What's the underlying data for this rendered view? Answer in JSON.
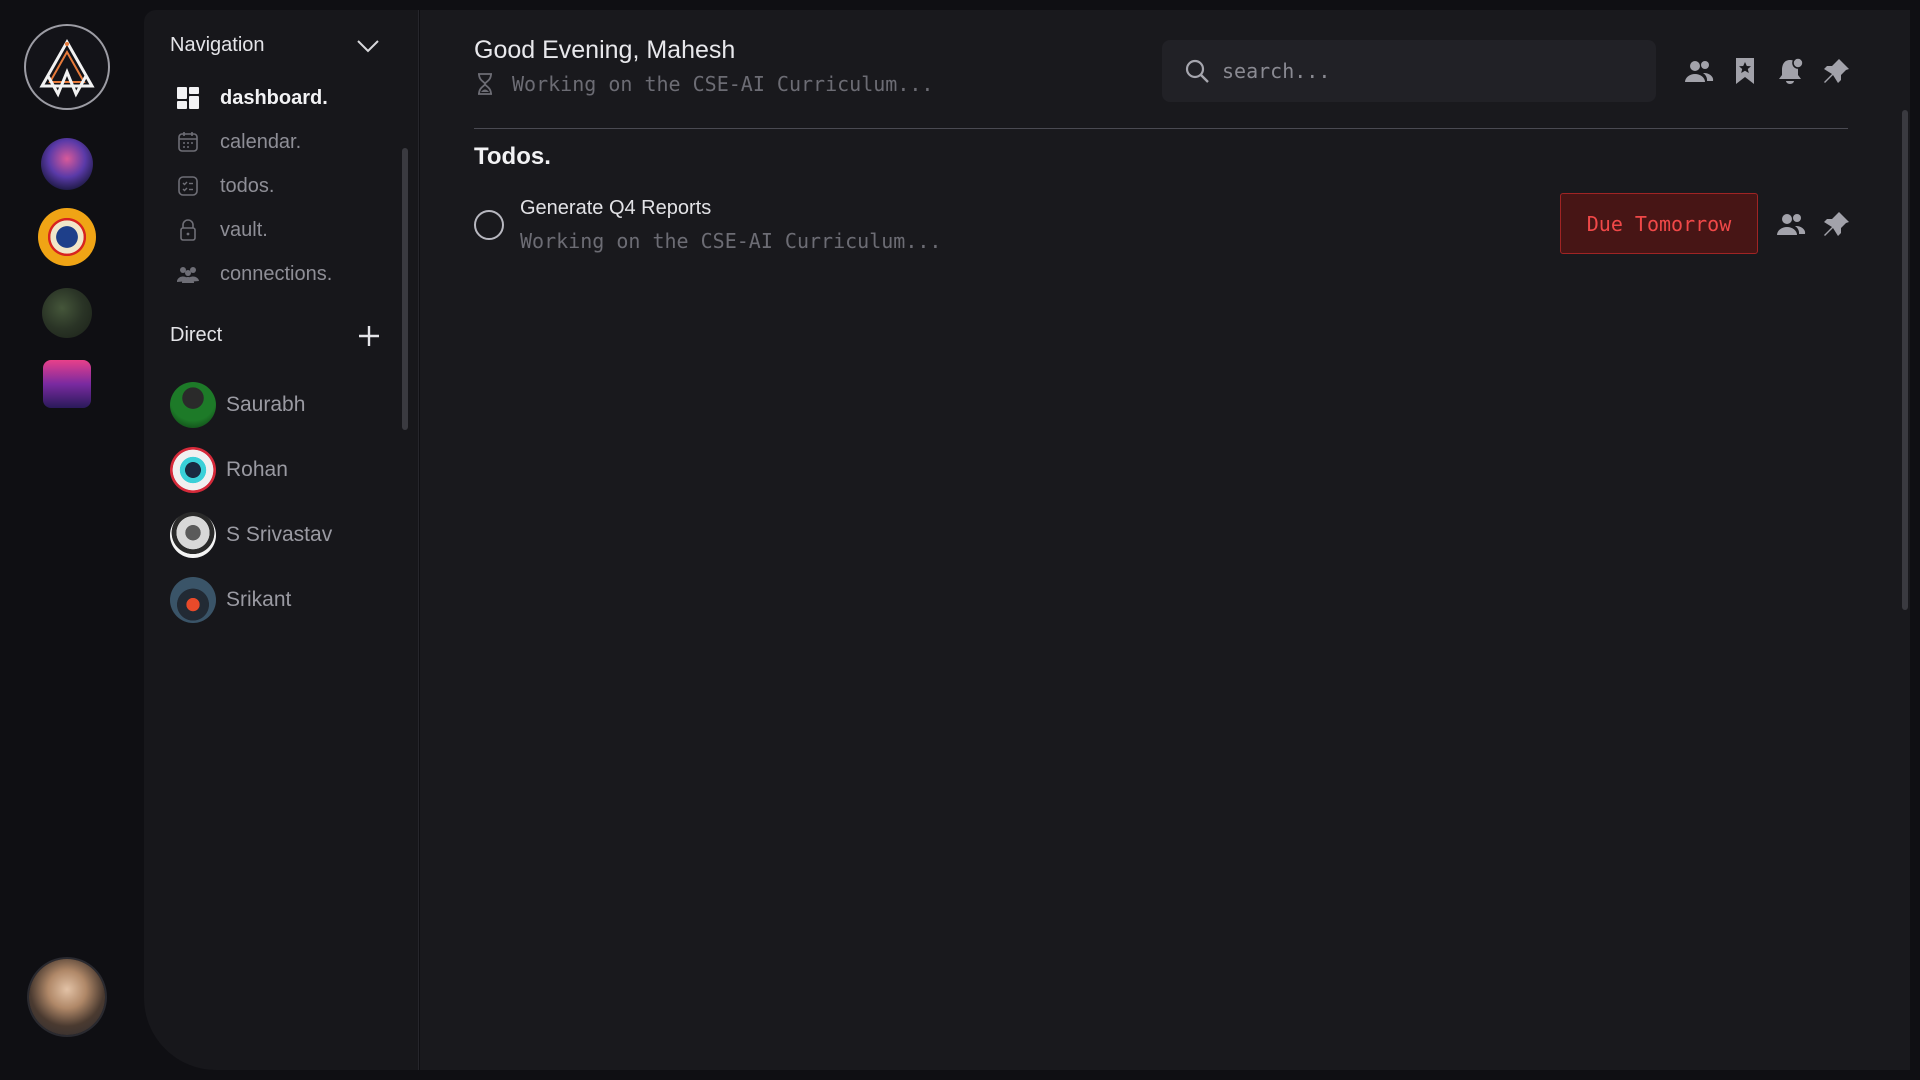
{
  "sidebar": {
    "nav_title": "Navigation",
    "items": [
      {
        "label": "dashboard.",
        "icon": "dashboard-icon",
        "active": true
      },
      {
        "label": "calendar.",
        "icon": "calendar-icon"
      },
      {
        "label": "todos.",
        "icon": "todos-icon"
      },
      {
        "label": "vault.",
        "icon": "lock-icon"
      },
      {
        "label": "connections.",
        "icon": "connections-icon"
      }
    ],
    "direct_title": "Direct",
    "direct": [
      {
        "name": "Saurabh"
      },
      {
        "name": "Rohan"
      },
      {
        "name": "S Srivastav"
      },
      {
        "name": "Srikant"
      }
    ]
  },
  "header": {
    "greeting": "Good Evening, Mahesh",
    "status": "Working on the CSE-AI Curriculum...",
    "search_placeholder": "search..."
  },
  "todos": {
    "title": "Todos.",
    "items": [
      {
        "title": "Generate Q4 Reports",
        "subtitle": "Working on the CSE-AI Curriculum...",
        "due": "Due Tomorrow"
      }
    ]
  },
  "colors": {
    "accent_red": "#f04848",
    "background": "#0f0f13",
    "panel": "#17171b",
    "main": "#19191d"
  }
}
